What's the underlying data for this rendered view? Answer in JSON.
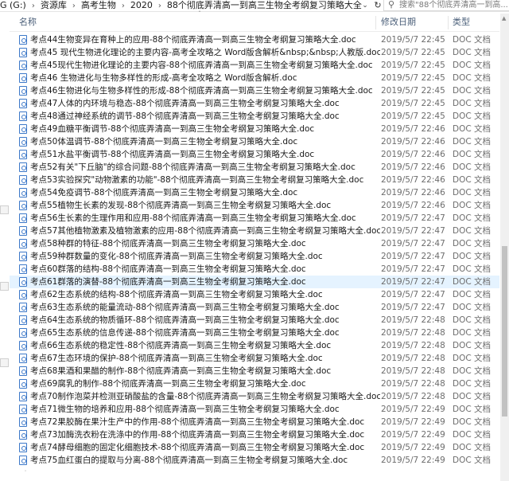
{
  "address_bar": {
    "breadcrumb": [
      "G (G:)",
      "资源库",
      "高考生物",
      "2020",
      "88个彻底弄清高一到高三生物全考纲复习策略大全"
    ],
    "separator": "›",
    "search_placeholder": "搜索\"88个彻底弄清高一到高..."
  },
  "columns": {
    "name": "名称",
    "modified": "修改日期",
    "type": "类型"
  },
  "files": [
    {
      "name": "考点44生物变异在育种上的应用-88个彻底弄清高一到高三生物全考纲复习策略大全.doc",
      "date": "2019/5/7 22:45",
      "type": "DOC 文档"
    },
    {
      "name": "考点45 现代生物进化理论的主要内容-高考全攻略之 Word版含解析&nbsp;&nbsp;人教版.doc",
      "date": "2019/5/7 22:45",
      "type": "DOC 文档"
    },
    {
      "name": "考点45现代生物进化理论的主要内容-88个彻底弄清高一到高三生物全考纲复习策略大全.doc",
      "date": "2019/5/7 22:45",
      "type": "DOC 文档"
    },
    {
      "name": "考点46 生物进化与生物多样性的形成-高考全攻略之 Word版含解析.doc",
      "date": "2019/5/7 22:45",
      "type": "DOC 文档"
    },
    {
      "name": "考点46生物进化与生物多样性的形成-88个彻底弄清高一到高三生物全考纲复习策略大全.doc",
      "date": "2019/5/7 22:45",
      "type": "DOC 文档"
    },
    {
      "name": "考点47人体的内环境与稳态-88个彻底弄清高一到高三生物全考纲复习策略大全.doc",
      "date": "2019/5/7 22:45",
      "type": "DOC 文档"
    },
    {
      "name": "考点48通过神经系统的调节-88个彻底弄清高一到高三生物全考纲复习策略大全.doc",
      "date": "2019/5/7 22:45",
      "type": "DOC 文档"
    },
    {
      "name": "考点49血糖平衡调节-88个彻底弄清高一到高三生物全考纲复习策略大全.doc",
      "date": "2019/5/7 22:46",
      "type": "DOC 文档"
    },
    {
      "name": "考点50体温调节-88个彻底弄清高一到高三生物全考纲复习策略大全.doc",
      "date": "2019/5/7 22:46",
      "type": "DOC 文档"
    },
    {
      "name": "考点51水盐平衡调节-88个彻底弄清高一到高三生物全考纲复习策略大全.doc",
      "date": "2019/5/7 22:46",
      "type": "DOC 文档"
    },
    {
      "name": "考点52有关\"下丘脑\"的综合问题-88个彻底弄清高一到高三生物全考纲复习策略大全.doc",
      "date": "2019/5/7 22:46",
      "type": "DOC 文档"
    },
    {
      "name": "考点53实验探究\"动物激素的功能\"-88个彻底弄清高一到高三生物全考纲复习策略大全.doc",
      "date": "2019/5/7 22:46",
      "type": "DOC 文档"
    },
    {
      "name": "考点54免疫调节-88个彻底弄清高一到高三生物全考纲复习策略大全.doc",
      "date": "2019/5/7 22:46",
      "type": "DOC 文档"
    },
    {
      "name": "考点55植物生长素的发现-88个彻底弄清高一到高三生物全考纲复习策略大全.doc",
      "date": "2019/5/7 22:46",
      "type": "DOC 文档"
    },
    {
      "name": "考点56生长素的生理作用和应用-88个彻底弄清高一到高三生物全考纲复习策略大全.doc",
      "date": "2019/5/7 22:47",
      "type": "DOC 文档"
    },
    {
      "name": "考点57其他植物激素及植物激素的应用-88个彻底弄清高一到高三生物全考纲复习策略大全.doc",
      "date": "2019/5/7 22:47",
      "type": "DOC 文档"
    },
    {
      "name": "考点58种群的特征-88个彻底弄清高一到高三生物全考纲复习策略大全.doc",
      "date": "2019/5/7 22:47",
      "type": "DOC 文档"
    },
    {
      "name": "考点59种群数量的变化-88个彻底弄清高一到高三生物全考纲复习策略大全.doc",
      "date": "2019/5/7 22:47",
      "type": "DOC 文档"
    },
    {
      "name": "考点60群落的结构-88个彻底弄清高一到高三生物全考纲复习策略大全.doc",
      "date": "2019/5/7 22:47",
      "type": "DOC 文档"
    },
    {
      "name": "考点61群落的演替-88个彻底弄清高一到高三生物全考纲复习策略大全.doc",
      "date": "2019/5/7 22:47",
      "type": "DOC 文档"
    },
    {
      "name": "考点62生态系统的结构-88个彻底弄清高一到高三生物全考纲复习策略大全.doc",
      "date": "2019/5/7 22:47",
      "type": "DOC 文档"
    },
    {
      "name": "考点63生态系统的能量流动-88个彻底弄清高一到高三生物全考纲复习策略大全.doc",
      "date": "2019/5/7 22:47",
      "type": "DOC 文档"
    },
    {
      "name": "考点64生态系统的物质循环-88个彻底弄清高一到高三生物全考纲复习策略大全.doc",
      "date": "2019/5/7 22:48",
      "type": "DOC 文档"
    },
    {
      "name": "考点65生态系统的信息传递-88个彻底弄清高一到高三生物全考纲复习策略大全.doc",
      "date": "2019/5/7 22:48",
      "type": "DOC 文档"
    },
    {
      "name": "考点66生态系统的稳定性-88个彻底弄清高一到高三生物全考纲复习策略大全.doc",
      "date": "2019/5/7 22:48",
      "type": "DOC 文档"
    },
    {
      "name": "考点67生态环境的保护-88个彻底弄清高一到高三生物全考纲复习策略大全.doc",
      "date": "2019/5/7 22:48",
      "type": "DOC 文档"
    },
    {
      "name": "考点68果酒和果醋的制作-88个彻底弄清高一到高三生物全考纲复习策略大全.doc",
      "date": "2019/5/7 22:48",
      "type": "DOC 文档"
    },
    {
      "name": "考点69腐乳的制作-88个彻底弄清高一到高三生物全考纲复习策略大全.doc",
      "date": "2019/5/7 22:48",
      "type": "DOC 文档"
    },
    {
      "name": "考点70制作泡菜并检测亚硝酸盐的含量-88个彻底弄清高一到高三生物全考纲复习策略大全.doc",
      "date": "2019/5/7 22:48",
      "type": "DOC 文档"
    },
    {
      "name": "考点71微生物的培养和应用-88个彻底弄清高一到高三生物全考纲复习策略大全.doc",
      "date": "2019/5/7 22:49",
      "type": "DOC 文档"
    },
    {
      "name": "考点72果胶酶在果汁生产中的作用-88个彻底弄清高一到高三生物全考纲复习策略大全.doc",
      "date": "2019/5/7 22:49",
      "type": "DOC 文档"
    },
    {
      "name": "考点73加酶洗衣粉在洗涤中的作用-88个彻底弄清高一到高三生物全考纲复习策略大全.doc",
      "date": "2019/5/7 22:49",
      "type": "DOC 文档"
    },
    {
      "name": "考点74酵母细胞的固定化细胞技术-88个彻底弄清高一到高三生物全考纲复习策略大全.doc",
      "date": "2019/5/7 22:49",
      "type": "DOC 文档"
    },
    {
      "name": "考点75血红蛋白的提取与分离-88个彻底弄清高一到高三生物全考纲复习策略大全.doc",
      "date": "2019/5/7 22:49",
      "type": "DOC 文档"
    }
  ],
  "selected_index": 19,
  "colors": {
    "selection": "#e5f3ff",
    "header_text": "#4c607a",
    "icon_blue": "#3c78c8"
  }
}
